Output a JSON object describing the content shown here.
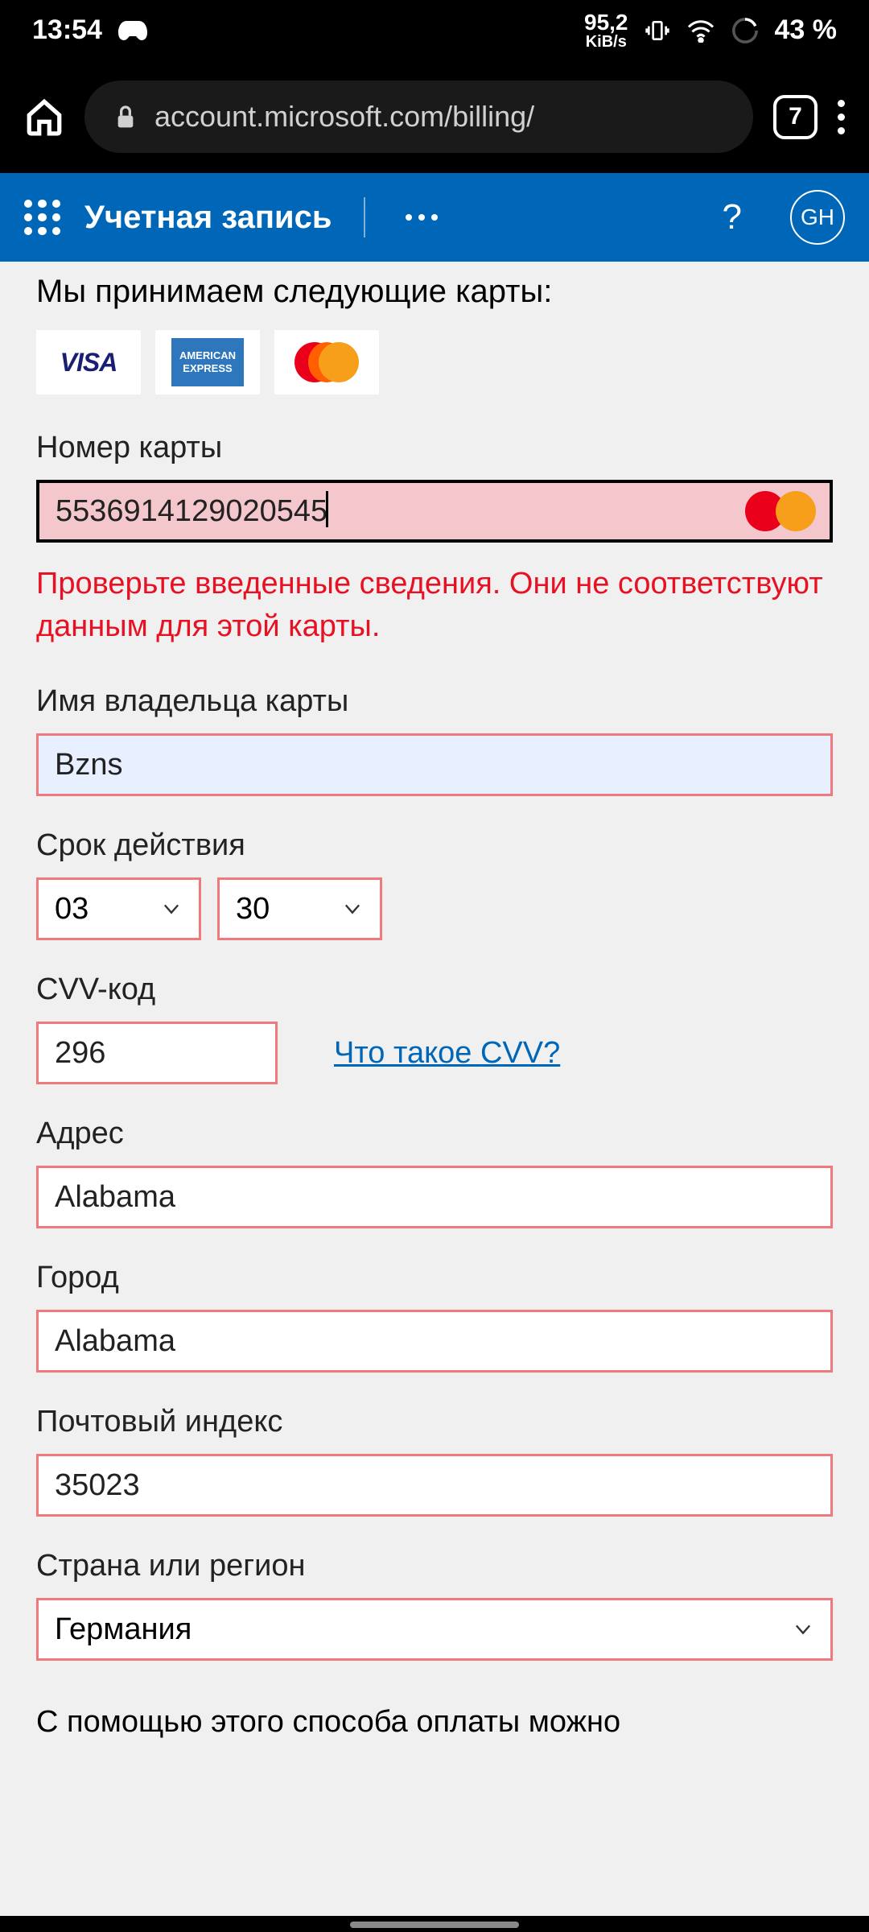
{
  "statusbar": {
    "time": "13:54",
    "netspeed": "95,2",
    "netunit": "KiB/s",
    "battery": "43 %"
  },
  "browser": {
    "url": "account.microsoft.com/billing/",
    "tabs": "7"
  },
  "msheader": {
    "title": "Учетная запись",
    "avatar": "GH",
    "help": "?"
  },
  "page": {
    "accepted_heading": "Мы принимаем следующие карты:",
    "card_number": {
      "label": "Номер карты",
      "value": "5536914129020545",
      "error": "Проверьте введенные сведения. Они не соответствуют данным для этой карты."
    },
    "cardholder": {
      "label": "Имя владельца карты",
      "value": "Bzns"
    },
    "expiry": {
      "label": "Срок действия",
      "month": "03",
      "year": "30"
    },
    "cvv": {
      "label": "CVV-код",
      "value": "296",
      "help_link": "Что такое CVV?"
    },
    "address": {
      "label": "Адрес",
      "value": "Alabama"
    },
    "city": {
      "label": "Город",
      "value": "Alabama"
    },
    "postal": {
      "label": "Почтовый индекс",
      "value": "35023"
    },
    "country": {
      "label": "Страна или регион",
      "value": "Германия"
    },
    "footer_text": "С помощью этого способа оплаты можно"
  },
  "card_logos": {
    "visa": "VISA",
    "amex": "AMERICAN EXPRESS"
  }
}
